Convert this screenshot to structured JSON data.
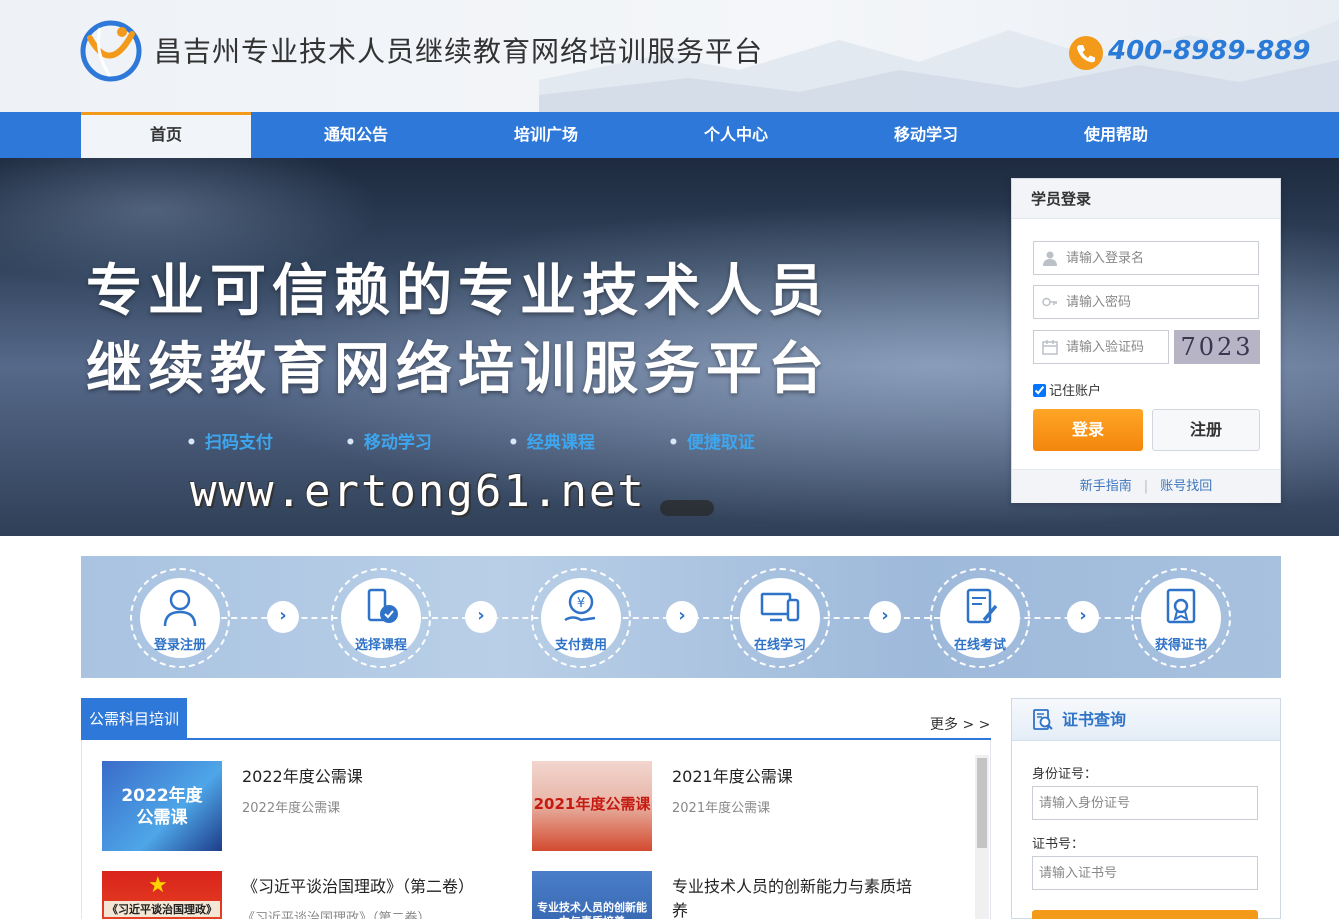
{
  "header": {
    "title": "昌吉州专业技术人员继续教育网络培训服务平台",
    "phone": "400-8989-889"
  },
  "nav": {
    "items": [
      "首页",
      "通知公告",
      "培训广场",
      "个人中心",
      "移动学习",
      "使用帮助"
    ],
    "active": "首页"
  },
  "banner": {
    "line1": "专业可信赖的专业技术人员",
    "line2": "继续教育网络培训服务平台",
    "features": [
      "扫码支付",
      "移动学习",
      "经典课程",
      "便捷取证"
    ],
    "watermark": "www.ertong61.net"
  },
  "login": {
    "title": "学员登录",
    "username_placeholder": "请输入登录名",
    "password_placeholder": "请输入密码",
    "captcha_placeholder": "请输入验证码",
    "captcha_text": "7023",
    "remember_label": "记住账户",
    "remember_checked": true,
    "login_button": "登录",
    "register_button": "注册",
    "guide_link": "新手指南",
    "recover_link": "账号找回"
  },
  "steps": [
    "登录注册",
    "选择课程",
    "支付费用",
    "在线学习",
    "在线考试",
    "获得证书"
  ],
  "public_courses": {
    "tab": "公需科目培训",
    "more": "更多 > >",
    "items": [
      {
        "title": "2022年度公需课",
        "subtitle": "2022年度公需课",
        "thumb_text": "2022年度\n公需课"
      },
      {
        "title": "2021年度公需课",
        "subtitle": "2021年度公需课",
        "thumb_text": "2021年度公需课"
      },
      {
        "title": "《习近平谈治国理政》（第二卷）",
        "subtitle": "《习近平谈治国理政》（第二卷）",
        "thumb_text": "《习近平谈治国理政》"
      },
      {
        "title": "专业技术人员的创新能力与素质培养",
        "subtitle": "",
        "thumb_text": "专业技术人员的创新能力与素质培养"
      }
    ]
  },
  "certificate": {
    "title": "证书查询",
    "id_label": "身份证号：",
    "id_placeholder": "请输入身份证号",
    "cert_label": "证书号：",
    "cert_placeholder": "请输入证书号"
  },
  "colors": {
    "brand_blue": "#2d78d8",
    "accent_orange": "#f39a1b",
    "feature_blue": "#3ea6ef"
  }
}
